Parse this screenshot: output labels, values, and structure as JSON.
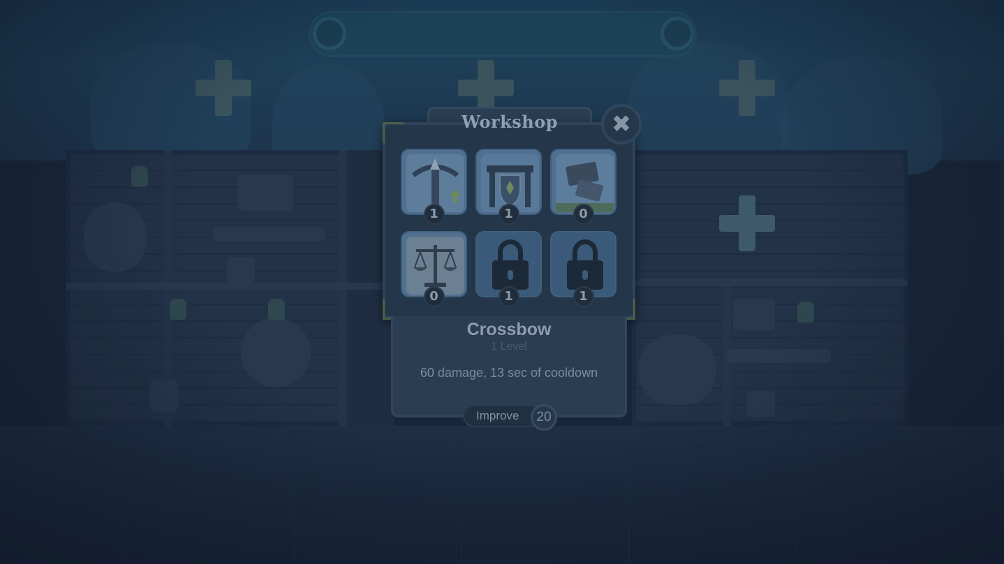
{
  "dialog": {
    "title": "Workshop",
    "close_icon": "close-icon"
  },
  "items": [
    {
      "name": "crossbow",
      "icon": "crossbow-icon",
      "count": "1"
    },
    {
      "name": "gate",
      "icon": "gate-icon",
      "count": "1"
    },
    {
      "name": "cards",
      "icon": "cards-icon",
      "count": "0"
    },
    {
      "name": "scales",
      "icon": "scales-icon",
      "count": "0"
    },
    {
      "name": "locked-1",
      "icon": "lock-icon",
      "count": "1"
    },
    {
      "name": "locked-2",
      "icon": "lock-icon",
      "count": "1"
    }
  ],
  "selected": {
    "name": "Crossbow",
    "level": "1 Level",
    "description": "60 damage, 13 sec of cooldown"
  },
  "improve": {
    "label": "Improve",
    "cost": "20"
  },
  "colors": {
    "dialog_bg": "#243649",
    "slot_bg": "#3b5a7a",
    "overlay": "#1c2a3d"
  }
}
